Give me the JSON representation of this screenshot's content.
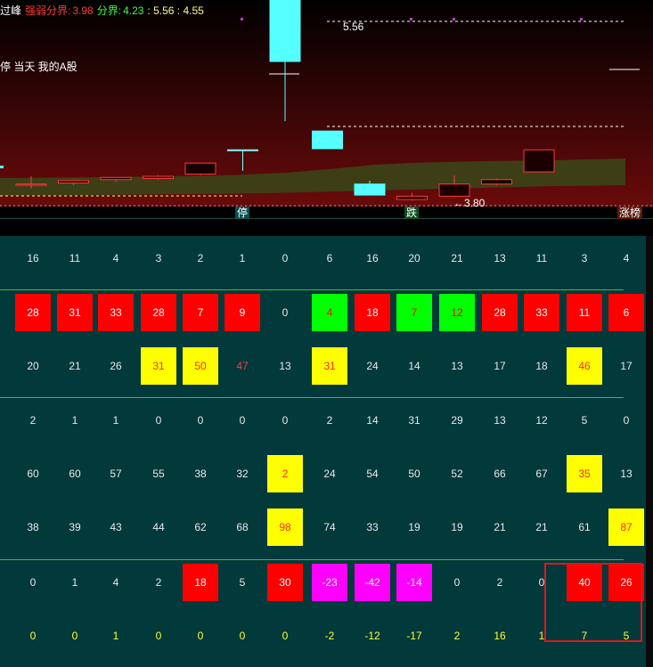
{
  "header": {
    "prefix": "过峰",
    "strong_label": "强弱分界:",
    "strong_value": "3.98",
    "boundary_label": "分界:",
    "boundary_value": "4.23",
    "extra_values": ": 5.56 : 4.55",
    "prefix_color": "#ffffff",
    "strong_color": "#ff3a3a",
    "boundary_color": "#3fff3f",
    "extra_color": "#ffff80"
  },
  "chart": {
    "sub_label": "停 当天 我的A股",
    "high_annotation": "5.56",
    "low_annotation": "←3.80",
    "markers": [
      {
        "text": "停",
        "color": "#ffffff",
        "bg": "#0b4f4f"
      },
      {
        "text": "跌",
        "color": "#ffffff",
        "bg": "#0b4f1f"
      },
      {
        "text": "涨榜",
        "color": "#ffffff",
        "bg": "#5a1a10"
      }
    ],
    "candles": [
      {
        "o": 3.62,
        "h": 3.7,
        "l": 3.59,
        "c": 3.63,
        "color": "#ff3a3a",
        "hollow": true
      },
      {
        "o": 3.64,
        "h": 3.66,
        "l": 3.62,
        "c": 3.66,
        "color": "#ff3a3a",
        "hollow": true
      },
      {
        "o": 3.67,
        "h": 3.69,
        "l": 3.65,
        "c": 3.69,
        "color": "#ff3a3a",
        "hollow": true
      },
      {
        "o": 3.68,
        "h": 3.71,
        "l": 3.67,
        "c": 3.7,
        "color": "#ff3a3a",
        "hollow": true
      },
      {
        "o": 3.72,
        "h": 3.82,
        "l": 3.71,
        "c": 3.82,
        "color": "#ff3a3a",
        "hollow": true
      },
      {
        "o": 3.94,
        "h": 3.94,
        "l": 3.75,
        "c": 3.94,
        "color": "#80ffff",
        "hollow": false
      },
      {
        "o": 5.56,
        "h": 5.56,
        "l": 4.2,
        "c": 4.74,
        "color": "#55ffff",
        "hollow": false
      },
      {
        "o": 4.11,
        "h": 4.11,
        "l": 3.95,
        "c": 3.95,
        "color": "#55ffff",
        "hollow": false
      },
      {
        "o": 3.63,
        "h": 3.66,
        "l": 3.53,
        "c": 3.53,
        "color": "#55ffff",
        "hollow": false
      },
      {
        "o": 3.52,
        "h": 3.55,
        "l": 3.48,
        "c": 3.49,
        "color": "#ff3a3a",
        "hollow": true
      },
      {
        "o": 3.52,
        "h": 3.71,
        "l": 3.51,
        "c": 3.63,
        "color": "#ff3a3a",
        "hollow": true
      },
      {
        "o": 3.63,
        "h": 3.68,
        "l": 3.62,
        "c": 3.67,
        "color": "#ff3a3a",
        "hollow": true
      },
      {
        "o": 3.74,
        "h": 3.94,
        "l": 3.74,
        "c": 3.94,
        "color": "#ff3a3a",
        "hollow": true
      }
    ]
  },
  "table": {
    "rows": [
      {
        "cells": [
          {
            "v": "16",
            "s": "plain"
          },
          {
            "v": "11",
            "s": "plain"
          },
          {
            "v": "4",
            "s": "plain"
          },
          {
            "v": "3",
            "s": "plain"
          },
          {
            "v": "2",
            "s": "plain"
          },
          {
            "v": "1",
            "s": "plain"
          },
          {
            "v": "0",
            "s": "plain"
          },
          {
            "v": "6",
            "s": "plain"
          },
          {
            "v": "16",
            "s": "plain"
          },
          {
            "v": "20",
            "s": "plain"
          },
          {
            "v": "21",
            "s": "plain"
          },
          {
            "v": "13",
            "s": "plain"
          },
          {
            "v": "11",
            "s": "plain"
          },
          {
            "v": "3",
            "s": "plain"
          },
          {
            "v": "4",
            "s": "plain"
          }
        ]
      },
      {
        "cells": [
          {
            "v": "28",
            "s": "red"
          },
          {
            "v": "31",
            "s": "red"
          },
          {
            "v": "33",
            "s": "red"
          },
          {
            "v": "28",
            "s": "red"
          },
          {
            "v": "7",
            "s": "red"
          },
          {
            "v": "9",
            "s": "red"
          },
          {
            "v": "0",
            "s": "plain"
          },
          {
            "v": "4",
            "s": "green"
          },
          {
            "v": "18",
            "s": "red"
          },
          {
            "v": "7",
            "s": "green"
          },
          {
            "v": "12",
            "s": "green"
          },
          {
            "v": "28",
            "s": "red"
          },
          {
            "v": "33",
            "s": "red"
          },
          {
            "v": "11",
            "s": "red"
          },
          {
            "v": "6",
            "s": "red"
          }
        ]
      },
      {
        "cells": [
          {
            "v": "20",
            "s": "plain"
          },
          {
            "v": "21",
            "s": "plain"
          },
          {
            "v": "26",
            "s": "plain"
          },
          {
            "v": "31",
            "s": "yellow"
          },
          {
            "v": "50",
            "s": "yellow"
          },
          {
            "v": "47",
            "s": "redtext"
          },
          {
            "v": "13",
            "s": "plain"
          },
          {
            "v": "31",
            "s": "yellow"
          },
          {
            "v": "24",
            "s": "plain"
          },
          {
            "v": "14",
            "s": "plain"
          },
          {
            "v": "13",
            "s": "plain"
          },
          {
            "v": "17",
            "s": "plain"
          },
          {
            "v": "18",
            "s": "plain"
          },
          {
            "v": "46",
            "s": "yellow"
          },
          {
            "v": "17",
            "s": "plain"
          }
        ]
      },
      {
        "cells": [
          {
            "v": "2",
            "s": "plain"
          },
          {
            "v": "1",
            "s": "plain"
          },
          {
            "v": "1",
            "s": "plain"
          },
          {
            "v": "0",
            "s": "plain"
          },
          {
            "v": "0",
            "s": "plain"
          },
          {
            "v": "0",
            "s": "plain"
          },
          {
            "v": "0",
            "s": "plain"
          },
          {
            "v": "2",
            "s": "plain"
          },
          {
            "v": "14",
            "s": "plain"
          },
          {
            "v": "31",
            "s": "plain"
          },
          {
            "v": "29",
            "s": "plain"
          },
          {
            "v": "13",
            "s": "plain"
          },
          {
            "v": "12",
            "s": "plain"
          },
          {
            "v": "5",
            "s": "plain"
          },
          {
            "v": "0",
            "s": "plain"
          }
        ]
      },
      {
        "cells": [
          {
            "v": "60",
            "s": "plain"
          },
          {
            "v": "60",
            "s": "plain"
          },
          {
            "v": "57",
            "s": "plain"
          },
          {
            "v": "55",
            "s": "plain"
          },
          {
            "v": "38",
            "s": "plain"
          },
          {
            "v": "32",
            "s": "plain"
          },
          {
            "v": "2",
            "s": "yellow"
          },
          {
            "v": "24",
            "s": "plain"
          },
          {
            "v": "54",
            "s": "plain"
          },
          {
            "v": "50",
            "s": "plain"
          },
          {
            "v": "52",
            "s": "plain"
          },
          {
            "v": "66",
            "s": "plain"
          },
          {
            "v": "67",
            "s": "plain"
          },
          {
            "v": "35",
            "s": "yellow"
          },
          {
            "v": "13",
            "s": "plain"
          }
        ]
      },
      {
        "cells": [
          {
            "v": "38",
            "s": "plain"
          },
          {
            "v": "39",
            "s": "plain"
          },
          {
            "v": "43",
            "s": "plain"
          },
          {
            "v": "44",
            "s": "plain"
          },
          {
            "v": "62",
            "s": "plain"
          },
          {
            "v": "68",
            "s": "plain"
          },
          {
            "v": "98",
            "s": "yellow"
          },
          {
            "v": "74",
            "s": "plain"
          },
          {
            "v": "33",
            "s": "plain"
          },
          {
            "v": "19",
            "s": "plain"
          },
          {
            "v": "19",
            "s": "plain"
          },
          {
            "v": "21",
            "s": "plain"
          },
          {
            "v": "21",
            "s": "plain"
          },
          {
            "v": "61",
            "s": "plain"
          },
          {
            "v": "87",
            "s": "yellow"
          }
        ]
      },
      {
        "cells": [
          {
            "v": "0",
            "s": "plain"
          },
          {
            "v": "1",
            "s": "plain"
          },
          {
            "v": "4",
            "s": "plain"
          },
          {
            "v": "2",
            "s": "plain"
          },
          {
            "v": "18",
            "s": "red"
          },
          {
            "v": "5",
            "s": "plain"
          },
          {
            "v": "30",
            "s": "red"
          },
          {
            "v": "-23",
            "s": "magenta"
          },
          {
            "v": "-42",
            "s": "magenta"
          },
          {
            "v": "-14",
            "s": "magenta"
          },
          {
            "v": "0",
            "s": "plain"
          },
          {
            "v": "2",
            "s": "plain"
          },
          {
            "v": "0",
            "s": "plain"
          },
          {
            "v": "40",
            "s": "red"
          },
          {
            "v": "26",
            "s": "red"
          }
        ]
      },
      {
        "cells": [
          {
            "v": "0",
            "s": "ytext"
          },
          {
            "v": "0",
            "s": "ytext"
          },
          {
            "v": "1",
            "s": "ytext"
          },
          {
            "v": "0",
            "s": "ytext"
          },
          {
            "v": "0",
            "s": "ytext"
          },
          {
            "v": "0",
            "s": "ytext"
          },
          {
            "v": "0",
            "s": "ytext"
          },
          {
            "v": "-2",
            "s": "ytext"
          },
          {
            "v": "-12",
            "s": "ytext"
          },
          {
            "v": "-17",
            "s": "ytext"
          },
          {
            "v": "2",
            "s": "ytext"
          },
          {
            "v": "16",
            "s": "ytext"
          },
          {
            "v": "1",
            "s": "ytext"
          },
          {
            "v": "7",
            "s": "ytext"
          },
          {
            "v": "5",
            "s": "ytext"
          }
        ]
      }
    ]
  }
}
